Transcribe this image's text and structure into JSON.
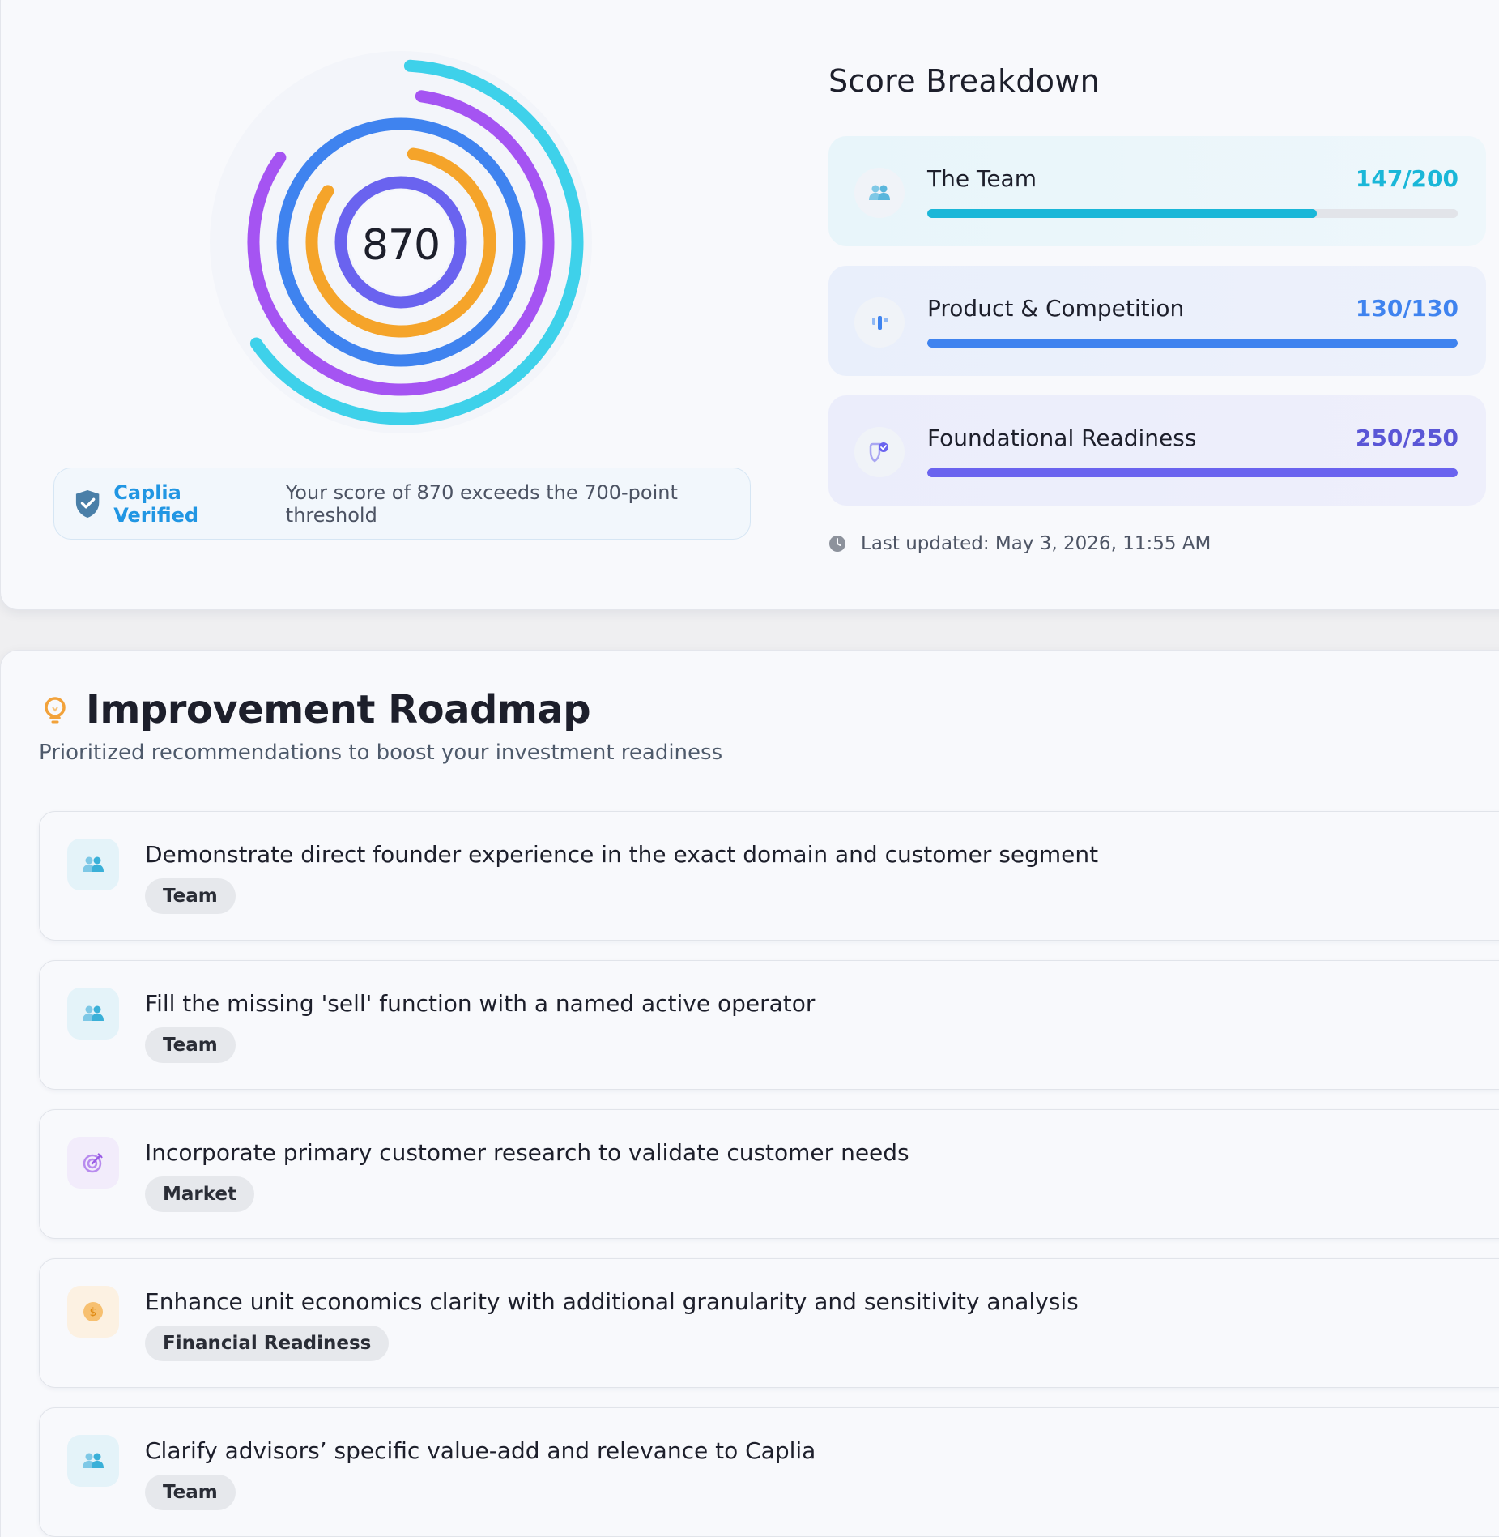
{
  "score": {
    "value": "870",
    "rings": [
      {
        "name": "cyan",
        "color": "#3ed1ea",
        "start": 3,
        "end": 235
      },
      {
        "name": "purple",
        "color": "#a554f2",
        "start": 8,
        "end": 305
      },
      {
        "name": "blue",
        "color": "#3f83ef",
        "start": 0,
        "end": 360
      },
      {
        "name": "orange",
        "color": "#f5a42a",
        "start": 8,
        "end": 305
      },
      {
        "name": "indigo",
        "color": "#6a63ef",
        "start": 0,
        "end": 360
      }
    ]
  },
  "verified": {
    "label": "Caplia Verified",
    "message": "Your score of 870 exceeds the 700-point threshold",
    "icon": "shield-check-icon"
  },
  "breakdown": {
    "title": "Score Breakdown",
    "items": [
      {
        "name": "The Team",
        "value": "147/200",
        "progress": 0.735,
        "color": "#1ab7d8",
        "icon": "team-icon"
      },
      {
        "name": "Product & Competition",
        "value": "130/130",
        "progress": 1.0,
        "color": "#3f83ef",
        "icon": "bar-chart-icon"
      },
      {
        "name": "Foundational Readiness",
        "value": "250/250",
        "progress": 1.0,
        "color": "#6a63ef",
        "icon": "shield-badge-icon"
      }
    ],
    "updated": "Last updated: May 3, 2026, 11:55 AM"
  },
  "roadmap": {
    "title": "Improvement Roadmap",
    "subtitle": "Prioritized recommendations to boost your investment readiness",
    "icon": "lightbulb-icon",
    "items": [
      {
        "text": "Demonstrate direct founder experience in the exact domain and customer segment",
        "tag": "Team",
        "icon": "team-icon"
      },
      {
        "text": "Fill the missing 'sell' function with a named active operator",
        "tag": "Team",
        "icon": "team-icon"
      },
      {
        "text": "Incorporate primary customer research to validate customer needs",
        "tag": "Market",
        "icon": "target-icon"
      },
      {
        "text": "Enhance unit economics clarity with additional granularity and sensitivity analysis",
        "tag": "Financial Readiness",
        "icon": "dollar-icon"
      },
      {
        "text": "Clarify advisors’ specific value-add and relevance to Caplia",
        "tag": "Team",
        "icon": "team-icon"
      }
    ]
  }
}
